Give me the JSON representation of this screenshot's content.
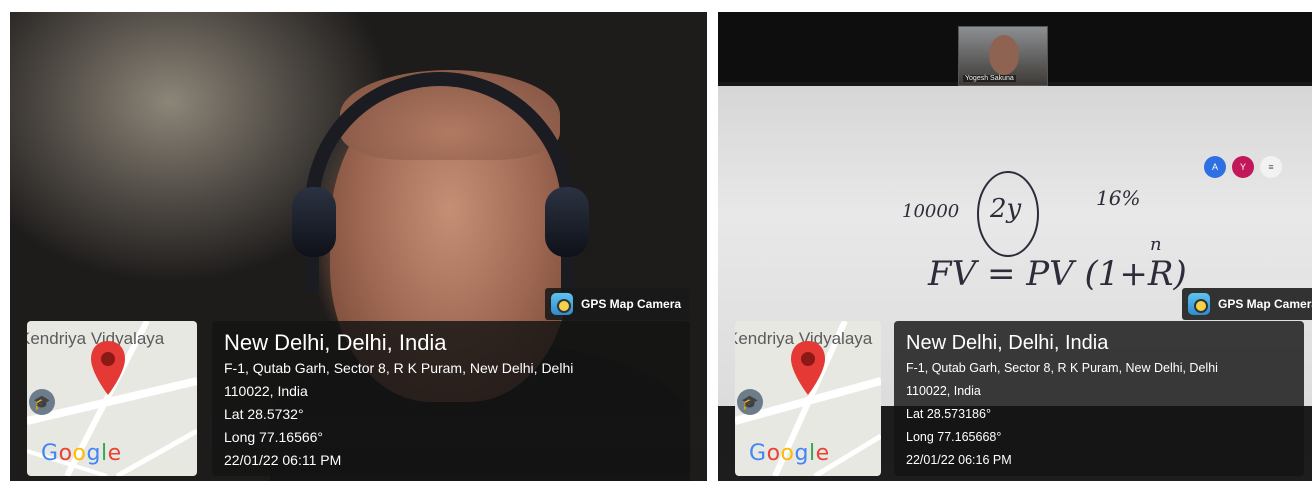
{
  "panels": [
    {
      "gps_badge": "GPS Map Camera",
      "map_label": "Kendriya Vidyalaya",
      "map_brand": "Google",
      "place": "New Delhi, Delhi, India",
      "address_line1": "F-1, Qutab Garh, Sector 8, R K Puram, New Delhi, Delhi",
      "address_line2": "110022, India",
      "lat": "Lat 28.5732°",
      "long": "Long 77.16566°",
      "datetime": "22/01/22 06:11 PM"
    },
    {
      "gps_badge": "GPS Map Camera",
      "map_label": "Kendriya Vidyalaya",
      "map_brand": "Google",
      "place": "New Delhi, Delhi, India",
      "address_line1": "F-1, Qutab Garh, Sector 8, R K Puram, New Delhi, Delhi",
      "address_line2": "110022, India",
      "lat": "Lat 28.573186°",
      "long": "Long 77.165668°",
      "datetime": "22/01/22 06:16 PM"
    }
  ],
  "whiteboard": {
    "principal": "10000",
    "term": "2y",
    "rate": "16%",
    "formula": "FV = PV (1+R)",
    "exponent": "n"
  },
  "video_thumb_name": "Yogesh Sakuna",
  "colors": {
    "overlay": "#141414",
    "pin": "#e53935",
    "wb_blue": "#2f6fe4",
    "wb_pink": "#c2185b"
  }
}
